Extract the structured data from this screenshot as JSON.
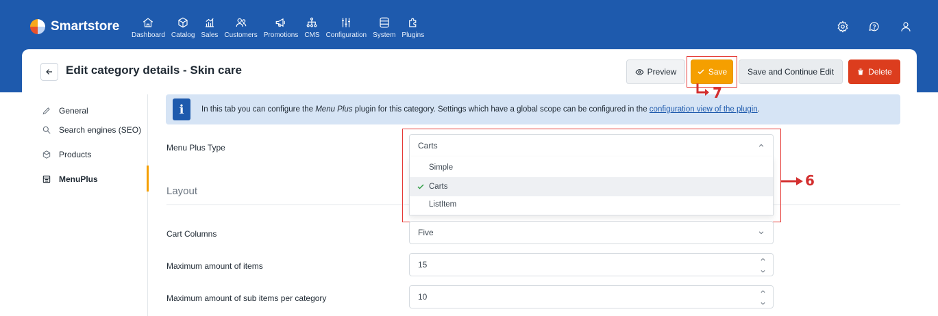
{
  "app": {
    "name": "Smartstore"
  },
  "nav": [
    {
      "label": "Dashboard",
      "icon": "home-icon"
    },
    {
      "label": "Catalog",
      "icon": "cube-icon"
    },
    {
      "label": "Sales",
      "icon": "chart-icon"
    },
    {
      "label": "Customers",
      "icon": "users-icon"
    },
    {
      "label": "Promotions",
      "icon": "megaphone-icon"
    },
    {
      "label": "CMS",
      "icon": "sitemap-icon"
    },
    {
      "label": "Configuration",
      "icon": "sliders-icon"
    },
    {
      "label": "System",
      "icon": "database-icon"
    },
    {
      "label": "Plugins",
      "icon": "puzzle-icon"
    }
  ],
  "header": {
    "title": "Edit category details - Skin care",
    "preview_label": "Preview",
    "save_label": "Save",
    "save_continue_label": "Save and Continue Edit",
    "delete_label": "Delete"
  },
  "sidebar": {
    "items": [
      {
        "label": "General",
        "icon": "pencil-icon"
      },
      {
        "label": "Search engines (SEO)",
        "icon": "search-icon"
      },
      {
        "label": "Products",
        "icon": "cube-icon"
      },
      {
        "label": "MenuPlus",
        "icon": "menu-icon"
      }
    ]
  },
  "info": {
    "text_before": "In this tab you can configure the ",
    "text_em": "Menu Plus",
    "text_middle": " plugin for this category. Settings which have a global scope can be configured in the ",
    "link": "configuration view of the plugin",
    "text_after": "."
  },
  "form": {
    "menu_type_label": "Menu Plus Type",
    "menu_type_value": "Carts",
    "menu_type_options": [
      "Simple",
      "Carts",
      "ListItem"
    ],
    "menu_type_selected": "Carts",
    "section_layout": "Layout",
    "cart_columns_label": "Cart Columns",
    "cart_columns_value": "Five",
    "max_items_label": "Maximum amount of items",
    "max_items_value": "15",
    "max_sub_label": "Maximum amount of sub items per category",
    "max_sub_value": "10"
  },
  "annotations": {
    "save_marker": "7",
    "dropdown_marker": "6"
  },
  "colors": {
    "brand": "#1e5aad",
    "save": "#f59f00",
    "delete": "#dc3d1e",
    "annotation": "#e53935"
  }
}
